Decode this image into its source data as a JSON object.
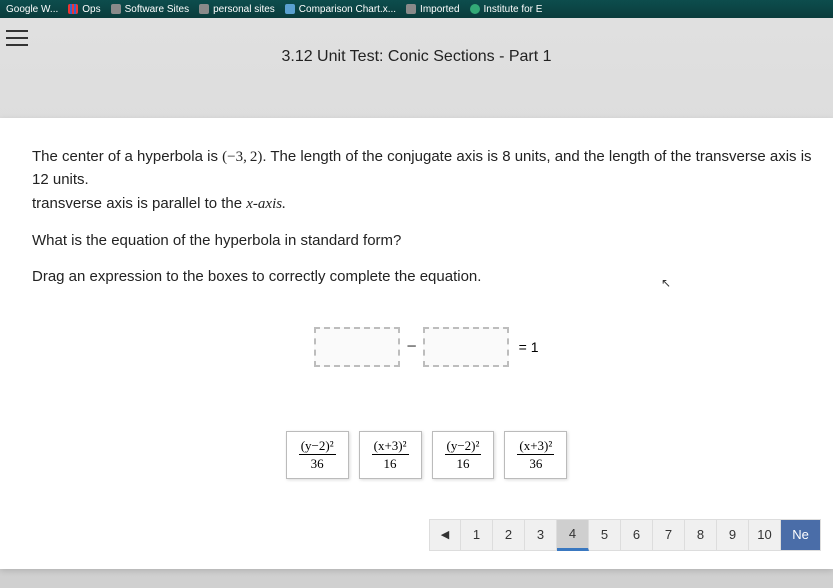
{
  "bookmarks": {
    "b0": "Google W...",
    "b1": "Ops",
    "b2": "Software Sites",
    "b3": "personal sites",
    "b4": "Comparison Chart.x...",
    "b5": "Imported",
    "b6": "Institute for E"
  },
  "test_title": "3.12 Unit Test: Conic Sections - Part 1",
  "question": {
    "p1_a": "The center of a hyperbola is ",
    "p1_center": "(−3, 2)",
    "p1_b": ". The length of the conjugate axis is 8 units, and the length of the transverse axis is 12 units.",
    "p2_partial": "transverse axis is parallel to the ",
    "p2_axis": "x-axis.",
    "p3": "What is the equation of the hyperbola in standard form?",
    "p4": "Drag an expression to the boxes to correctly complete the equation."
  },
  "equation": {
    "minus": "−",
    "equals": "= 1"
  },
  "tiles": {
    "t1_num": "(y−2)²",
    "t1_den": "36",
    "t2_num": "(x+3)²",
    "t2_den": "16",
    "t3_num": "(y−2)²",
    "t3_den": "16",
    "t4_num": "(x+3)²",
    "t4_den": "36"
  },
  "pager": {
    "prev_glyph": "◀",
    "p1": "1",
    "p2": "2",
    "p3": "3",
    "p4": "4",
    "p5": "5",
    "p6": "6",
    "p7": "7",
    "p8": "8",
    "p9": "9",
    "p10": "10",
    "next": "Ne"
  }
}
